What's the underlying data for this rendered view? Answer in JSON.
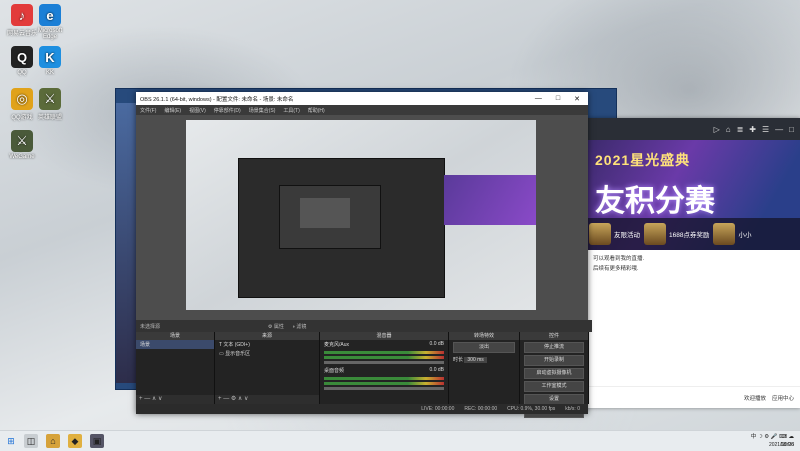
{
  "desktop": {
    "icons": [
      {
        "name": "网易云音乐",
        "symbol": "♪",
        "color": "#e23b3b"
      },
      {
        "name": "Microsoft Edge",
        "symbol": "e",
        "color": "#1b7fd6"
      },
      {
        "name": "QQ",
        "symbol": "Q",
        "color": "#222"
      },
      {
        "name": "KK",
        "symbol": "K",
        "color": "#1e8fe0"
      },
      {
        "name": "QQ游戏",
        "symbol": "◎",
        "color": "#e0a21a"
      },
      {
        "name": "英雄联盟",
        "symbol": "⚔",
        "color": "#5b6b3a"
      },
      {
        "name": "WeGame",
        "symbol": "⚔",
        "color": "#4a5a3a"
      }
    ]
  },
  "obs": {
    "title": "OBS 26.1.1 (64-bit, windows) - 配置文件: 未命名 - 场景: 未命名",
    "menu": [
      "文件(F)",
      "编辑(E)",
      "视图(V)",
      "停靠部件(D)",
      "场景集合(S)",
      "工具(T)",
      "帮助(H)"
    ],
    "preview_label": "未选择源",
    "props_btn": "属性",
    "filter_btn": "滤镜",
    "docks": {
      "scenes": {
        "title": "场景",
        "items": [
          "场景"
        ]
      },
      "sources": {
        "title": "来源",
        "items": [
          "文本 (GDI+)",
          "显示音乐区"
        ]
      },
      "mixer": {
        "title": "混音器",
        "channels": [
          {
            "name": "麦克风/Aux",
            "db": "0.0 dB"
          },
          {
            "name": "桌面音频",
            "db": "0.0 dB"
          }
        ]
      },
      "transitions": {
        "title": "转场特效",
        "type": "淡出",
        "duration_label": "时长",
        "duration": "300 ms"
      },
      "controls": {
        "title": "控件",
        "buttons": [
          "停止推流",
          "开始录制",
          "启动虚拟摄像机",
          "工作室模式",
          "设置",
          "退出"
        ]
      }
    },
    "status": {
      "live": "LIVE: 00:00:00",
      "rec": "REC: 00:00:00",
      "cpu": "CPU: 0.9%, 30.00 fps",
      "kb": "kb/s: 0"
    }
  },
  "browser": {
    "banner_line1": "2021星光盛典",
    "banner_line2": "友积分赛",
    "thumbs": [
      "友限活动",
      "1688点券奖励",
      "小小"
    ],
    "text_lines": [
      "可以观看到我的直播.",
      "后续有更多精彩哦."
    ],
    "footer": [
      "欢迎播放",
      "应用中心"
    ]
  },
  "taskbar": {
    "apps": [
      "◫",
      "⌂",
      "◆",
      "▣"
    ],
    "tray_icons": "中 ☽ ⚙ 🎤 ⌨ ☁",
    "time": "18:06",
    "date": "2021/10/28"
  }
}
